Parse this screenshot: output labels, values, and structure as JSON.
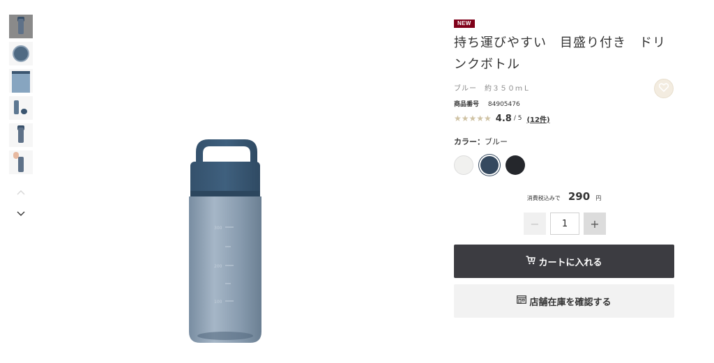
{
  "gallery": {
    "thumbnails": [
      {
        "name": "thumb-1",
        "active": true
      },
      {
        "name": "thumb-2",
        "active": false
      },
      {
        "name": "thumb-3",
        "active": false
      },
      {
        "name": "thumb-4",
        "active": false
      },
      {
        "name": "thumb-5",
        "active": false
      },
      {
        "name": "thumb-6",
        "active": false
      }
    ],
    "prev_icon": "chevron-up-icon",
    "next_icon": "chevron-down-icon",
    "main_image": {
      "bottle_color": "#5f7790",
      "cap_color": "#3b5a76",
      "scale_marks": [
        "300",
        "200",
        "100"
      ]
    }
  },
  "product": {
    "badge": "NEW",
    "title": "持ち運びやすい　目盛り付き　ドリンクボトル",
    "variant": "ブルー　約３５０ｍＬ",
    "code_label": "商品番号",
    "code": "84905476",
    "rating": {
      "stars": "★★★★★",
      "value": "4.8",
      "max": "/ 5",
      "reviews": "(12件)"
    },
    "favorite_icon": "heart-icon",
    "color_label": "カラー：",
    "color_value": "ブルー",
    "colors": [
      {
        "name": "white",
        "hex": "#f1f1ef"
      },
      {
        "name": "blue",
        "hex": "#35495f",
        "selected": true
      },
      {
        "name": "black",
        "hex": "#25272c"
      }
    ]
  },
  "purchase": {
    "price_prefix": "消費税込みで",
    "price": "290",
    "price_unit": "円",
    "quantity": "1",
    "minus": "−",
    "plus": "+",
    "cart_label": "カートに入れる",
    "store_label": "店舗在庫を確認する"
  },
  "colors": {
    "badge": "#7f0019",
    "cart_button": "#3c3c41",
    "store_button": "#f2f2f2",
    "star": "#cfc2a3"
  }
}
